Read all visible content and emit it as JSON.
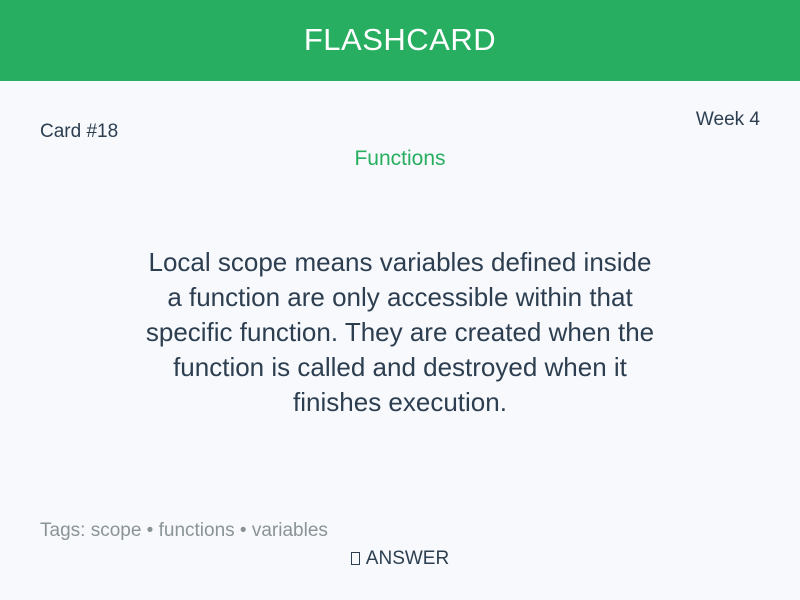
{
  "header": {
    "title": "FLASHCARD"
  },
  "card": {
    "number": "Card #18",
    "week": "Week 4",
    "topic": "Functions",
    "content": "Local scope means variables defined inside a function are only accessible within that specific function. They are created when the function is called and destroyed when it finishes execution.",
    "tags": "Tags: scope • functions • variables"
  },
  "answer": {
    "label": "ANSWER",
    "icon": "answer-icon"
  },
  "colors": {
    "accent": "#27ae60",
    "text": "#2c3e50",
    "muted": "#8a9497",
    "background": "#f7f9fc"
  }
}
